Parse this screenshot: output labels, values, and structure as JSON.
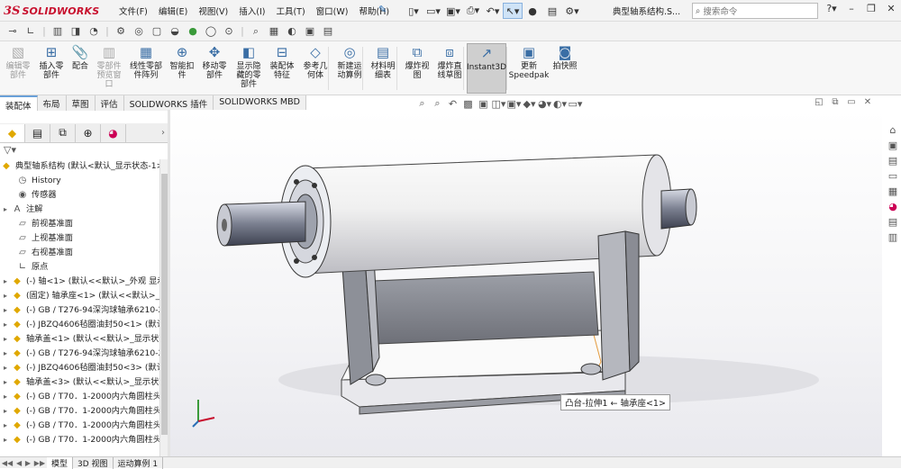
{
  "app": {
    "logo_ds": "3S",
    "logo_text": "SOLIDWORKS"
  },
  "menu": [
    "文件(F)",
    "编辑(E)",
    "视图(V)",
    "插入(I)",
    "工具(T)",
    "窗口(W)",
    "帮助(H)"
  ],
  "doc_title": "典型轴系结构.S...",
  "search": {
    "placeholder": "搜索命令"
  },
  "ribbon": [
    {
      "label": "编辑零\n部件",
      "icon": "edit-component-icon",
      "disabled": true
    },
    {
      "label": "插入零\n部件",
      "icon": "insert-component-icon",
      "disabled": false
    },
    {
      "label": "配合",
      "icon": "mate-icon",
      "disabled": false
    },
    {
      "label": "零部件\n预览窗\n口",
      "icon": "component-preview-icon",
      "disabled": true
    },
    {
      "label": "线性零部\n件阵列",
      "icon": "linear-pattern-icon",
      "disabled": false
    },
    {
      "label": "智能扣\n件",
      "icon": "smart-fasteners-icon",
      "disabled": false
    },
    {
      "label": "移动零\n部件",
      "icon": "move-component-icon",
      "disabled": false
    },
    {
      "label": "显示隐\n藏的零\n部件",
      "icon": "show-hidden-icon",
      "disabled": false
    },
    {
      "label": "装配体\n特征",
      "icon": "assembly-features-icon",
      "disabled": false
    },
    {
      "label": "参考几\n何体",
      "icon": "reference-geometry-icon",
      "disabled": false
    },
    {
      "label": "新建运\n动算例",
      "icon": "new-motion-study-icon",
      "disabled": false
    },
    {
      "label": "材料明\n细表",
      "icon": "bom-icon",
      "disabled": false
    },
    {
      "label": "爆炸视\n图",
      "icon": "exploded-view-icon",
      "disabled": false
    },
    {
      "label": "爆炸直\n线草图",
      "icon": "explode-line-sketch-icon",
      "disabled": false
    },
    {
      "label": "Instant3D",
      "icon": "instant3d-icon",
      "disabled": false,
      "active": true
    },
    {
      "label": "更新\nSpeedpak",
      "icon": "update-speedpak-icon",
      "disabled": false
    },
    {
      "label": "拍快照",
      "icon": "snapshot-icon",
      "disabled": false
    }
  ],
  "tabs": [
    "装配体",
    "布局",
    "草图",
    "评估",
    "SOLIDWORKS 插件",
    "SOLIDWORKS MBD"
  ],
  "tree": {
    "root": "典型轴系结构 (默认<默认_显示状态-1>)",
    "items": [
      {
        "label": "History",
        "icon": "history-icon",
        "exp": ""
      },
      {
        "label": "传感器",
        "icon": "sensor-icon",
        "exp": ""
      },
      {
        "label": "注解",
        "icon": "annotation-icon",
        "exp": "▸"
      },
      {
        "label": "前视基准面",
        "icon": "plane-icon",
        "exp": ""
      },
      {
        "label": "上视基准面",
        "icon": "plane-icon",
        "exp": ""
      },
      {
        "label": "右视基准面",
        "icon": "plane-icon",
        "exp": ""
      },
      {
        "label": "原点",
        "icon": "origin-icon",
        "exp": ""
      },
      {
        "label": "(-) 轴<1> (默认<<默认>_外观 显示",
        "icon": "part-icon",
        "exp": "▸"
      },
      {
        "label": "(固定) 轴承座<1> (默认<<默认>_显",
        "icon": "part-icon",
        "exp": "▸"
      },
      {
        "label": "(-) GB / T276-94深沟球轴承6210-2",
        "icon": "part-icon",
        "exp": "▸"
      },
      {
        "label": "(-) JBZQ4606毡圈油封50<1> (默认",
        "icon": "part-icon",
        "exp": "▸"
      },
      {
        "label": "轴承盖<1> (默认<<默认>_显示状态",
        "icon": "part-icon",
        "exp": "▸"
      },
      {
        "label": "(-) GB / T276-94深沟球轴承6210-2",
        "icon": "part-icon",
        "exp": "▸"
      },
      {
        "label": "(-) JBZQ4606毡圈油封50<3> (默认",
        "icon": "part-icon",
        "exp": "▸"
      },
      {
        "label": "轴承盖<3> (默认<<默认>_显示状态",
        "icon": "part-icon",
        "exp": "▸"
      },
      {
        "label": "(-) GB / T70．1-2000内六角圆柱头",
        "icon": "part-icon",
        "exp": "▸"
      },
      {
        "label": "(-) GB / T70．1-2000内六角圆柱头",
        "icon": "part-icon",
        "exp": "▸"
      },
      {
        "label": "(-) GB / T70．1-2000内六角圆柱头",
        "icon": "part-icon",
        "exp": "▸"
      },
      {
        "label": "(-) GB / T70．1-2000内六角圆柱头",
        "icon": "part-icon",
        "exp": "▸"
      }
    ]
  },
  "tooltip": "凸台-拉伸1 ← 轴承座<1>",
  "bottom_tabs": [
    "模型",
    "3D 视图",
    "运动算例 1"
  ],
  "colors": {
    "accent": "#2a6fb5",
    "brand": "#c8102e",
    "part": "#e0a800"
  }
}
